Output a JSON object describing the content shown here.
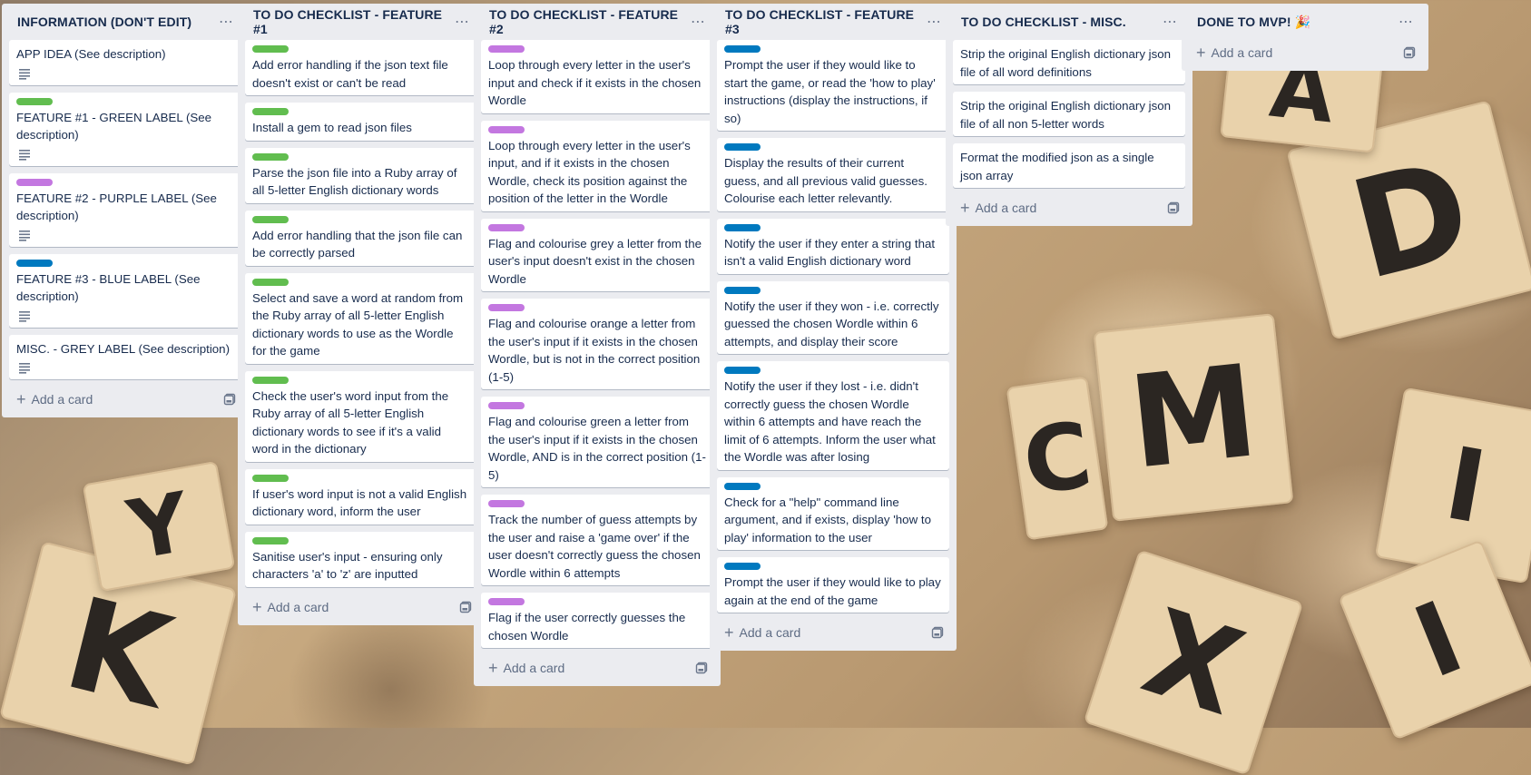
{
  "lists": [
    {
      "title": "INFORMATION (DON'T EDIT)",
      "add_label": "Add a card",
      "cards": [
        {
          "label": "",
          "text": "APP IDEA (See description)",
          "has_desc": true
        },
        {
          "label": "green",
          "text": "FEATURE #1 - GREEN LABEL (See description)",
          "has_desc": true
        },
        {
          "label": "purple",
          "text": "FEATURE #2 - PURPLE LABEL (See description)",
          "has_desc": true
        },
        {
          "label": "blue",
          "text": "FEATURE #3 - BLUE LABEL (See description)",
          "has_desc": true
        },
        {
          "label": "",
          "text": "MISC. - GREY LABEL (See description)",
          "has_desc": true
        }
      ]
    },
    {
      "title": "TO DO CHECKLIST - FEATURE #1",
      "add_label": "Add a card",
      "cards": [
        {
          "label": "green",
          "text": "Add error handling if the json text file doesn't exist or can't be read"
        },
        {
          "label": "green",
          "text": "Install a gem to read json files"
        },
        {
          "label": "green",
          "text": "Parse the json file into a Ruby array of all 5-letter English dictionary words"
        },
        {
          "label": "green",
          "text": "Add error handling that the json file can be correctly parsed"
        },
        {
          "label": "green",
          "text": "Select and save a word at random from the Ruby array of all 5-letter English dictionary words to use as the Wordle for the game"
        },
        {
          "label": "green",
          "text": "Check the user's word input from the Ruby array of all 5-letter English dictionary words to see if it's a valid word in the dictionary"
        },
        {
          "label": "green",
          "text": "If user's word input is not a valid English dictionary word, inform the user"
        },
        {
          "label": "green",
          "text": "Sanitise user's input - ensuring only characters 'a' to 'z' are inputted"
        }
      ]
    },
    {
      "title": "TO DO CHECKLIST - FEATURE #2",
      "add_label": "Add a card",
      "cards": [
        {
          "label": "purple",
          "text": "Loop through every letter in the user's input and check if it exists in the chosen Wordle"
        },
        {
          "label": "purple",
          "text": "Loop through every letter in the user's input, and if it exists in the chosen Wordle, check its position against the position of the letter in the Wordle"
        },
        {
          "label": "purple",
          "text": "Flag and colourise grey a letter from the user's input doesn't exist in the chosen Wordle"
        },
        {
          "label": "purple",
          "text": "Flag and colourise orange a letter from the user's input if it exists in the chosen Wordle, but is not in the correct position (1-5)"
        },
        {
          "label": "purple",
          "text": "Flag and colourise green a letter from the user's input if it exists in the chosen Wordle, AND is in the correct position (1-5)"
        },
        {
          "label": "purple",
          "text": "Track the number of guess attempts by the user and raise a 'game over' if the user doesn't correctly guess the chosen Wordle within 6 attempts"
        },
        {
          "label": "purple",
          "text": "Flag if the user correctly guesses the chosen Wordle"
        }
      ]
    },
    {
      "title": "TO DO CHECKLIST - FEATURE #3",
      "add_label": "Add a card",
      "cards": [
        {
          "label": "blue",
          "text": "Prompt the user if they would like to start the game, or read the 'how to play' instructions (display the instructions, if so)"
        },
        {
          "label": "blue",
          "text": "Display the results of their current guess, and all previous valid guesses. Colourise each letter relevantly."
        },
        {
          "label": "blue",
          "text": "Notify the user if they enter a string that isn't a valid English dictionary word"
        },
        {
          "label": "blue",
          "text": "Notify the user if they won - i.e. correctly guessed the chosen Wordle within 6 attempts, and display their score"
        },
        {
          "label": "blue",
          "text": "Notify the user if they lost - i.e. didn't correctly guess the chosen Wordle within 6 attempts and have reach the limit of 6 attempts. Inform the user what the Wordle was after losing"
        },
        {
          "label": "blue",
          "text": "Check for a \"help\" command line argument, and if exists, display 'how to play' information to the user"
        },
        {
          "label": "blue",
          "text": "Prompt the user if they would like to play again at the end of the game"
        }
      ]
    },
    {
      "title": "TO DO CHECKLIST - MISC.",
      "add_label": "Add a card",
      "cards": [
        {
          "label": "",
          "text": "Strip the original English dictionary json file of all word definitions"
        },
        {
          "label": "",
          "text": "Strip the original English dictionary json file of all non 5-letter words"
        },
        {
          "label": "",
          "text": "Format the modified json as a single json array"
        }
      ]
    },
    {
      "title": "DONE TO MVP! 🎉",
      "add_label": "Add a card",
      "cards": []
    }
  ],
  "icons": {
    "list_menu": "ellipsis-icon",
    "add": "plus-icon",
    "template": "card-template-icon",
    "description": "description-icon"
  },
  "colors": {
    "green": "#61bd4f",
    "purple": "#c377e0",
    "blue": "#0079bf",
    "list_bg": "#ebecf0"
  }
}
